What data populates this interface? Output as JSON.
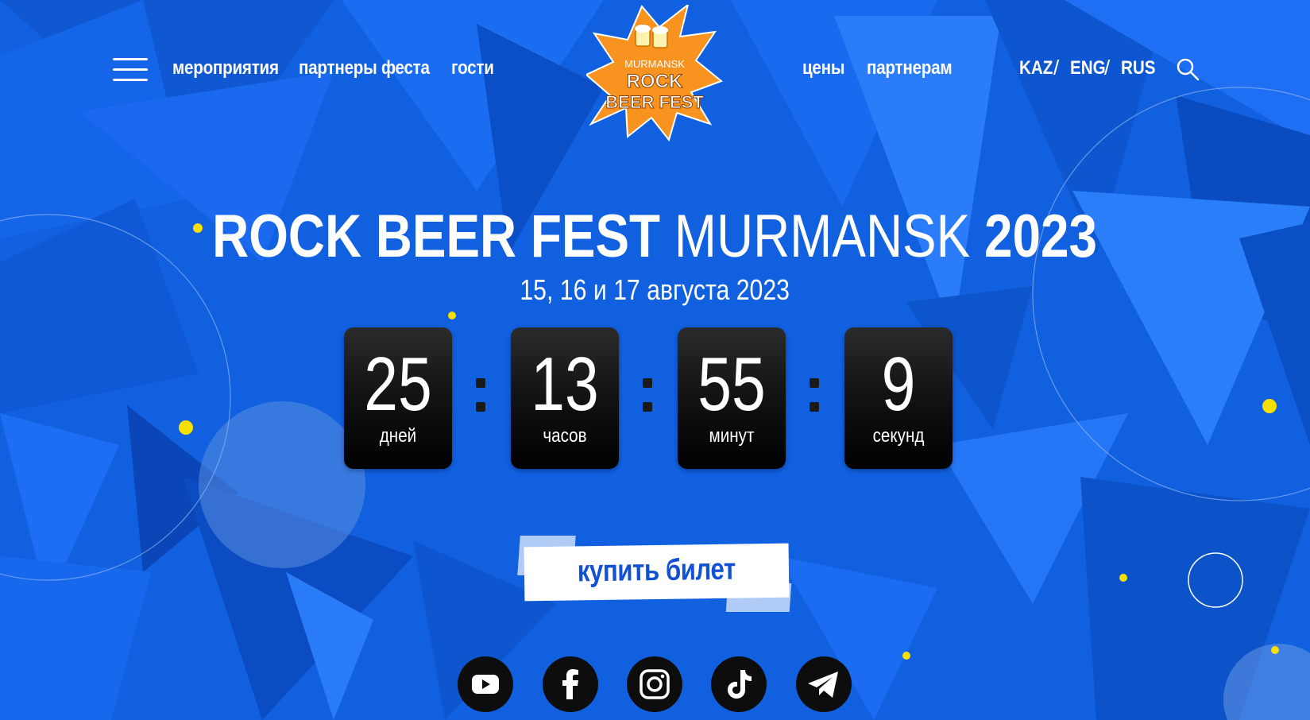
{
  "nav": {
    "left": [
      "мероприятия",
      "партнеры феста",
      "гости"
    ],
    "right": [
      "цены",
      "партнерам"
    ]
  },
  "languages": [
    "KAZ",
    "ENG",
    "RUS"
  ],
  "lang_separator": "/",
  "logo": {
    "line1": "MURMANSK",
    "line2": "ROCK",
    "line3": "BEER FEST"
  },
  "hero": {
    "title_bold": "ROCK BEER FEST",
    "title_light": "MURMANSK",
    "title_year": "2023",
    "dates": "15, 16 и 17 августа 2023"
  },
  "countdown": [
    {
      "value": "25",
      "label": "дней"
    },
    {
      "value": "13",
      "label": "часов"
    },
    {
      "value": "55",
      "label": "минут"
    },
    {
      "value": "9",
      "label": "секунд"
    }
  ],
  "cta": {
    "label": "купить билет"
  },
  "socials": [
    "youtube-icon",
    "facebook-icon",
    "instagram-icon",
    "tiktok-icon",
    "telegram-icon"
  ],
  "colors": {
    "background": "#1160e0",
    "accent_yellow": "#f5e000",
    "logo_orange": "#f7931e",
    "button_text": "#1250d6"
  }
}
